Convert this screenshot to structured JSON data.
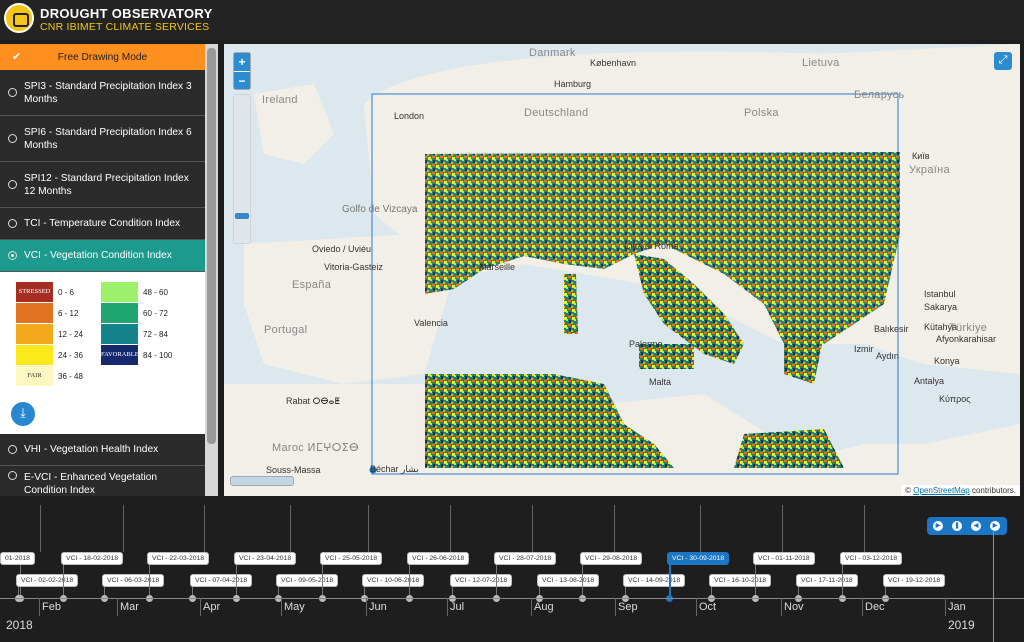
{
  "header": {
    "title": "DROUGHT OBSERVATORY",
    "subtitle": "CNR IBIMET CLIMATE SERVICES"
  },
  "sidebar": {
    "free_drawing": "Free Drawing Mode",
    "items": [
      {
        "label": "SPI3 - Standard Precipitation Index 3 Months",
        "active": false
      },
      {
        "label": "SPI6 - Standard Precipitation Index 6 Months",
        "active": false
      },
      {
        "label": "SPI12 - Standard Precipitation Index 12 Months",
        "active": false
      },
      {
        "label": "TCI - Temperature Condition Index",
        "active": false
      },
      {
        "label": "VCI - Vegetation Condition Index",
        "active": true
      },
      {
        "label": "VHI - Vegetation Health Index",
        "active": false
      },
      {
        "label": "E-VCI - Enhanced Vegetation Condition Index",
        "active": false
      }
    ]
  },
  "legend": {
    "left": [
      {
        "range": "0 - 6",
        "color": "#a52d23",
        "text": "STRESSED"
      },
      {
        "range": "6 - 12",
        "color": "#e0731f",
        "text": ""
      },
      {
        "range": "12 - 24",
        "color": "#f2a91b",
        "text": ""
      },
      {
        "range": "24 - 36",
        "color": "#fbe91a",
        "text": ""
      },
      {
        "range": "36 - 48",
        "color": "#fdf8bf",
        "text": "FAIR"
      }
    ],
    "right": [
      {
        "range": "48 - 60",
        "color": "#9df06a",
        "text": ""
      },
      {
        "range": "60 - 72",
        "color": "#1fa56f",
        "text": ""
      },
      {
        "range": "72 - 84",
        "color": "#15838a",
        "text": ""
      },
      {
        "range": "84 - 100",
        "color": "#15296e",
        "text": "FAVORABLE"
      }
    ]
  },
  "map": {
    "labels": [
      {
        "t": "Danmark",
        "c": "country"
      },
      {
        "t": "København",
        "c": "city"
      },
      {
        "t": "Lietuva",
        "c": "country"
      },
      {
        "t": "Hamburg",
        "c": "city"
      },
      {
        "t": "Беларусь",
        "c": "country"
      },
      {
        "t": "Ireland",
        "c": "country"
      },
      {
        "t": "London",
        "c": "city"
      },
      {
        "t": "Deutschland",
        "c": "country"
      },
      {
        "t": "Polska",
        "c": "country"
      },
      {
        "t": "Київ",
        "c": "city"
      },
      {
        "t": "Україна",
        "c": "country"
      },
      {
        "t": "Golfo de Vizcaya",
        "c": ""
      },
      {
        "t": "Oviedo / Uviéu",
        "c": "city"
      },
      {
        "t": "Vitoria-Gasteiz",
        "c": "city"
      },
      {
        "t": "España",
        "c": "country"
      },
      {
        "t": "Portugal",
        "c": "country"
      },
      {
        "t": "Valencia",
        "c": "city"
      },
      {
        "t": "Marseille",
        "c": "city"
      },
      {
        "t": "Città di Roma",
        "c": "city"
      },
      {
        "t": "Istanbul",
        "c": "city"
      },
      {
        "t": "Türkiye",
        "c": "country"
      },
      {
        "t": "Palermo",
        "c": "city"
      },
      {
        "t": "Malta",
        "c": "city"
      },
      {
        "t": "Rabat ⵔⴱⴰⵟ",
        "c": "city"
      },
      {
        "t": "Maroc ⵍⵎⵖⵔⵉⴱ",
        "c": "country"
      },
      {
        "t": "Souss-Massa",
        "c": "city"
      },
      {
        "t": "Béchar بشار",
        "c": "city"
      },
      {
        "t": "Κύπρος",
        "c": "city"
      },
      {
        "t": "Afyonkarahisar",
        "c": "city"
      },
      {
        "t": "Kütahya",
        "c": "city"
      },
      {
        "t": "Konya",
        "c": "city"
      },
      {
        "t": "Aydın",
        "c": "city"
      },
      {
        "t": "Sakarya",
        "c": "city"
      },
      {
        "t": "Balıkesir",
        "c": "city"
      },
      {
        "t": "Izmir",
        "c": "city"
      },
      {
        "t": "Antalya",
        "c": "city"
      }
    ],
    "attribution_link": "OpenStreetMap",
    "attribution_text": " contributors."
  },
  "timeline": {
    "events": [
      {
        "label": "01-2018",
        "row": 0
      },
      {
        "label": "VCI - 02-02-2018",
        "row": 1
      },
      {
        "label": "VCI - 18-02-2018",
        "row": 0
      },
      {
        "label": "VCI - 06-03-2018",
        "row": 1
      },
      {
        "label": "VCI - 22-03-2018",
        "row": 0
      },
      {
        "label": "VCI - 07-04-2018",
        "row": 1
      },
      {
        "label": "VCI - 23-04-2018",
        "row": 0
      },
      {
        "label": "VCI - 09-05-2018",
        "row": 1
      },
      {
        "label": "VCI - 25-05-2018",
        "row": 0
      },
      {
        "label": "VCI - 10-06-2018",
        "row": 1
      },
      {
        "label": "VCI - 26-06-2018",
        "row": 0
      },
      {
        "label": "VCI - 12-07-2018",
        "row": 1
      },
      {
        "label": "VCI - 28-07-2018",
        "row": 0
      },
      {
        "label": "VCI - 13-08-2018",
        "row": 1
      },
      {
        "label": "VCI - 29-08-2018",
        "row": 0
      },
      {
        "label": "VCI - 14-09-2018",
        "row": 1
      },
      {
        "label": "VCI - 30-09-2018",
        "row": 0,
        "active": true
      },
      {
        "label": "VCI - 16-10-2018",
        "row": 1
      },
      {
        "label": "VCI - 01-11-2018",
        "row": 0
      },
      {
        "label": "VCI - 17-11-2018",
        "row": 1
      },
      {
        "label": "VCI - 03-12-2018",
        "row": 0
      },
      {
        "label": "VCI - 19-12-2018",
        "row": 1
      }
    ],
    "months": [
      "Feb",
      "Mar",
      "Apr",
      "May",
      "Jun",
      "Jul",
      "Aug",
      "Sep",
      "Oct",
      "Nov",
      "Dec",
      "Jan"
    ],
    "years": [
      "2018",
      "2019"
    ],
    "controls": [
      "play",
      "pause",
      "back",
      "forward"
    ]
  }
}
